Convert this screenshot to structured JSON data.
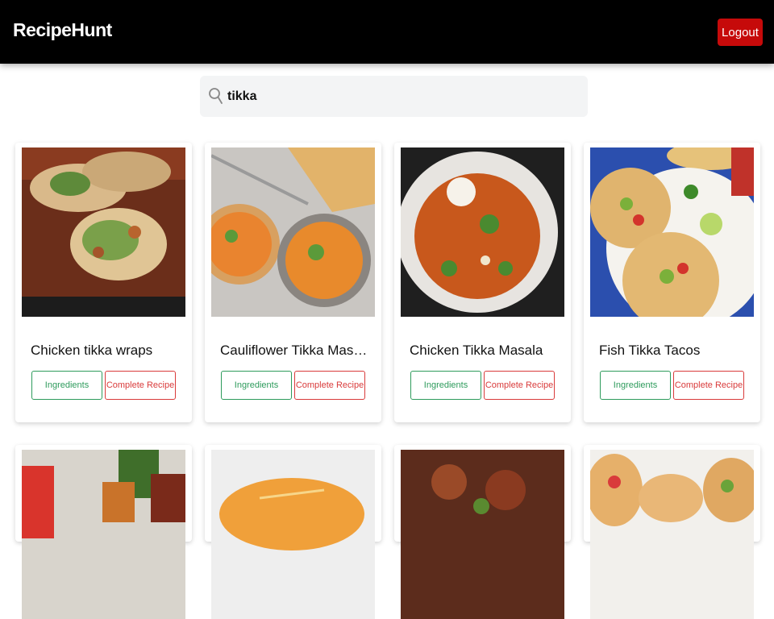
{
  "app": {
    "brand": "RecipeHunt",
    "logout_label": "Logout"
  },
  "search": {
    "value": "tikka",
    "icon": "search-icon"
  },
  "recipes": [
    {
      "title": "Chicken tikka wraps",
      "ingredients_label": "Ingredients",
      "recipe_label": "Complete Recipe"
    },
    {
      "title": "Cauliflower Tikka Masala w...",
      "ingredients_label": "Ingredients",
      "recipe_label": "Complete Recipe"
    },
    {
      "title": "Chicken Tikka Masala",
      "ingredients_label": "Ingredients",
      "recipe_label": "Complete Recipe"
    },
    {
      "title": "Fish Tikka Tacos",
      "ingredients_label": "Ingredients",
      "recipe_label": "Complete Recipe"
    }
  ],
  "colors": {
    "navbar": "#000000",
    "logout": "#c60a0a",
    "ingredients": "#2e9b5c",
    "complete_recipe": "#d93b3b"
  }
}
